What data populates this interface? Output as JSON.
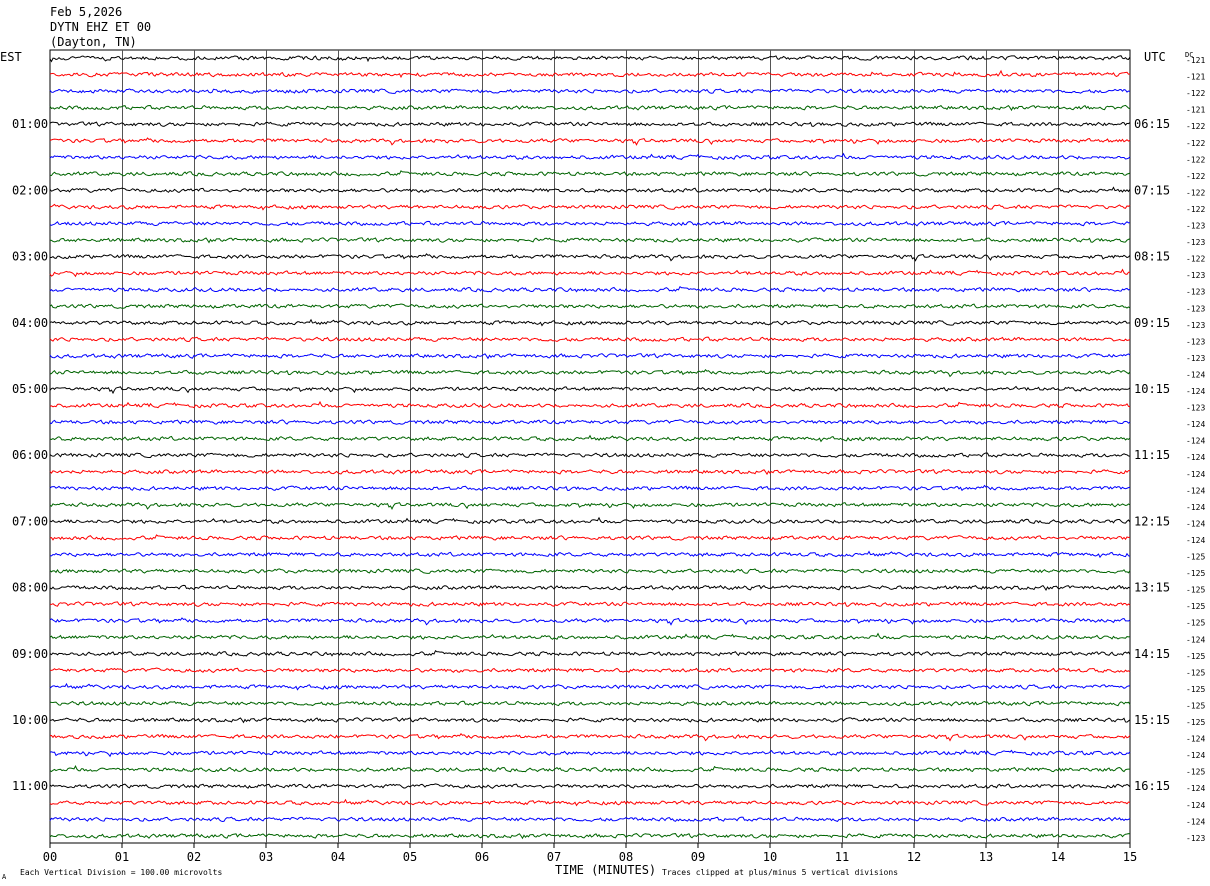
{
  "header": {
    "date": "Feb 5,2026",
    "station": "DYTN EHZ ET 00",
    "location": "(Dayton, TN)"
  },
  "labels": {
    "left_tz": "EST",
    "right_tz": "UTC",
    "dc_header": "DC",
    "xlabel": "TIME (MINUTES)",
    "footer_left": "Each Vertical Division =  100.00 microvolts",
    "footer_right": "Traces clipped at plus/minus 5 vertical divisions",
    "footer_mark": "A"
  },
  "colors": {
    "cycle": [
      "#000000",
      "#ff0000",
      "#0000ff",
      "#006400"
    ],
    "grid": "#000000",
    "background": "#ffffff"
  },
  "chart_data": {
    "type": "line",
    "title": "",
    "xlabel": "TIME (MINUTES)",
    "x_ticks": [
      "00",
      "01",
      "02",
      "03",
      "04",
      "05",
      "06",
      "07",
      "08",
      "09",
      "10",
      "11",
      "12",
      "13",
      "14",
      "15"
    ],
    "xlim": [
      0,
      15
    ],
    "trace_count": 48,
    "minutes_per_trace": 15,
    "left_hour_labels": [
      "01:00",
      "02:00",
      "03:00",
      "04:00",
      "05:00",
      "06:00",
      "07:00",
      "08:00",
      "09:00",
      "10:00",
      "11:00"
    ],
    "right_hour_labels": [
      "06:15",
      "07:15",
      "08:15",
      "09:15",
      "10:15",
      "11:15",
      "12:15",
      "13:15",
      "14:15",
      "15:15",
      "16:15"
    ],
    "dc_offsets": [
      -121,
      -121,
      -122,
      -121,
      -122,
      -122,
      -122,
      -122,
      -122,
      -122,
      -123,
      -123,
      -122,
      -123,
      -123,
      -123,
      -123,
      -123,
      -123,
      -124,
      -124,
      -123,
      -124,
      -124,
      -124,
      -124,
      -124,
      -124,
      -124,
      -124,
      -125,
      -125,
      -125,
      -125,
      -125,
      -124,
      -125,
      -125,
      -125,
      -125,
      -125,
      -124,
      -124,
      -125,
      -124,
      -124,
      -124,
      -123
    ],
    "series": [
      {
        "start_row": 0,
        "color": "#000000"
      },
      {
        "start_row": 1,
        "color": "#ff0000"
      },
      {
        "start_row": 2,
        "color": "#0000ff"
      },
      {
        "start_row": 3,
        "color": "#006400"
      }
    ]
  }
}
